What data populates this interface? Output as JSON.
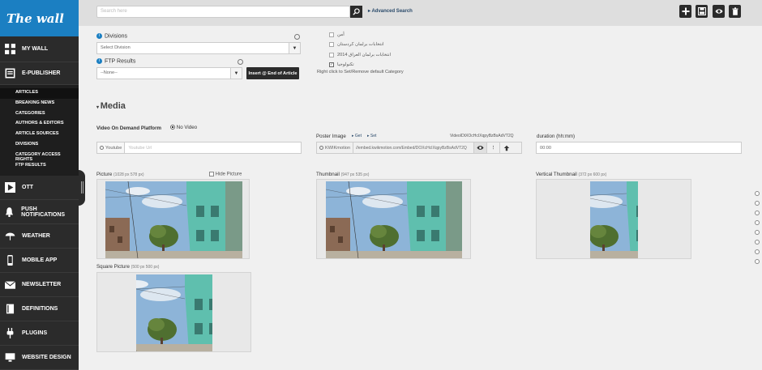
{
  "brand": {
    "logo_text": "The wall",
    "logo_sup": "360°"
  },
  "sidebar": {
    "my_wall": "MY WALL",
    "epublisher": "E-PUBLISHER",
    "sub_items": [
      "ARTICLES",
      "BREAKING NEWS",
      "CATEGORIES",
      "AUTHORS & EDITORS",
      "ARTICLE SOURCES",
      "DIVISIONS",
      "CATEGORY ACCESS RIGHTS",
      "FTP RESULTS"
    ],
    "items": [
      "OTT",
      "PUSH NOTIFICATIONS",
      "WEATHER",
      "MOBILE APP",
      "NEWSLETTER",
      "DEFINITIONS",
      "PLUGINS",
      "WEBSITE DESIGN"
    ]
  },
  "topbar": {
    "search_placeholder": "Search here",
    "advanced_search": "Advanced Search"
  },
  "form": {
    "divisions_label": "Divisions",
    "divisions_value": "Select Division",
    "ftp_label": "FTP Results",
    "ftp_value": "--None--",
    "insert_button": "Insert @ End of Article",
    "categories": [
      "أمن",
      "انتخابات برلمان كردستان",
      "انتخابات برلمان العراق 2014",
      "تكنولوجيا"
    ],
    "categories_hint": "Right click to Set/Remove default Category"
  },
  "media": {
    "section_title": "Media",
    "vod_label": "Video On Demand Platform",
    "vod_option": "No Video",
    "youtube_label": "Youtube",
    "youtube_placeholder": "Youtube Url",
    "poster_label": "Poster Image",
    "poster_get": "Get",
    "poster_set": "Set",
    "video_id": "VideoIDtXOcHcIXqpyBzBsAdVT2Q",
    "kwik_label": "KWIKmotion",
    "kwik_value": "//embed.kwikmotion.com/Embed/DOXcHcIXqpyBzBsAdVT2Q",
    "duration_label": "duration (hh:mm)",
    "duration_value": "00:00",
    "picture_label": "Picture",
    "picture_size": "(1028 px   578 px)",
    "hide_picture": "Hide Picture",
    "thumbnail_label": "Thumbnail",
    "thumbnail_size": "(947 px   535 px)",
    "vertical_label": "Vertical Thumbnail",
    "vertical_size": "(372 px   600 px)",
    "square_label": "Square Picture",
    "square_size": "(500 px   500 px)"
  },
  "colors": {
    "sidebar": "#2b2b2b",
    "brand": "#1b7fc2",
    "sky": "#7fa8cf",
    "building": "#5bb8a8",
    "tree": "#4a6a2a"
  }
}
